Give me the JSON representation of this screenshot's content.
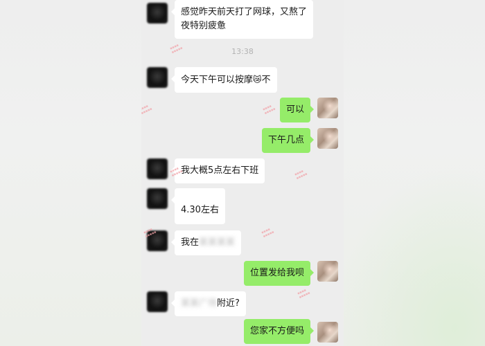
{
  "timestamp": "13:38",
  "messages": [
    {
      "side": "other",
      "line1": "感觉昨天前天打了网球，又熬了",
      "line2": "夜特别疲惫"
    },
    {
      "side": "other",
      "text_before": "今天下午可以按摩",
      "emoji": "😿",
      "text_after": "不"
    },
    {
      "side": "self",
      "text": "可以"
    },
    {
      "side": "self",
      "text": "下午几点"
    },
    {
      "side": "other",
      "text": "我大概5点左右下班"
    },
    {
      "side": "other",
      "text": "4.30左右"
    },
    {
      "side": "other",
      "text": "我在",
      "blurred": "某某某某"
    },
    {
      "side": "self",
      "text": "位置发给我呗"
    },
    {
      "side": "other",
      "blurred": "某某广场",
      "text": "附近?"
    },
    {
      "side": "self",
      "text": "您家不方便吗"
    }
  ]
}
